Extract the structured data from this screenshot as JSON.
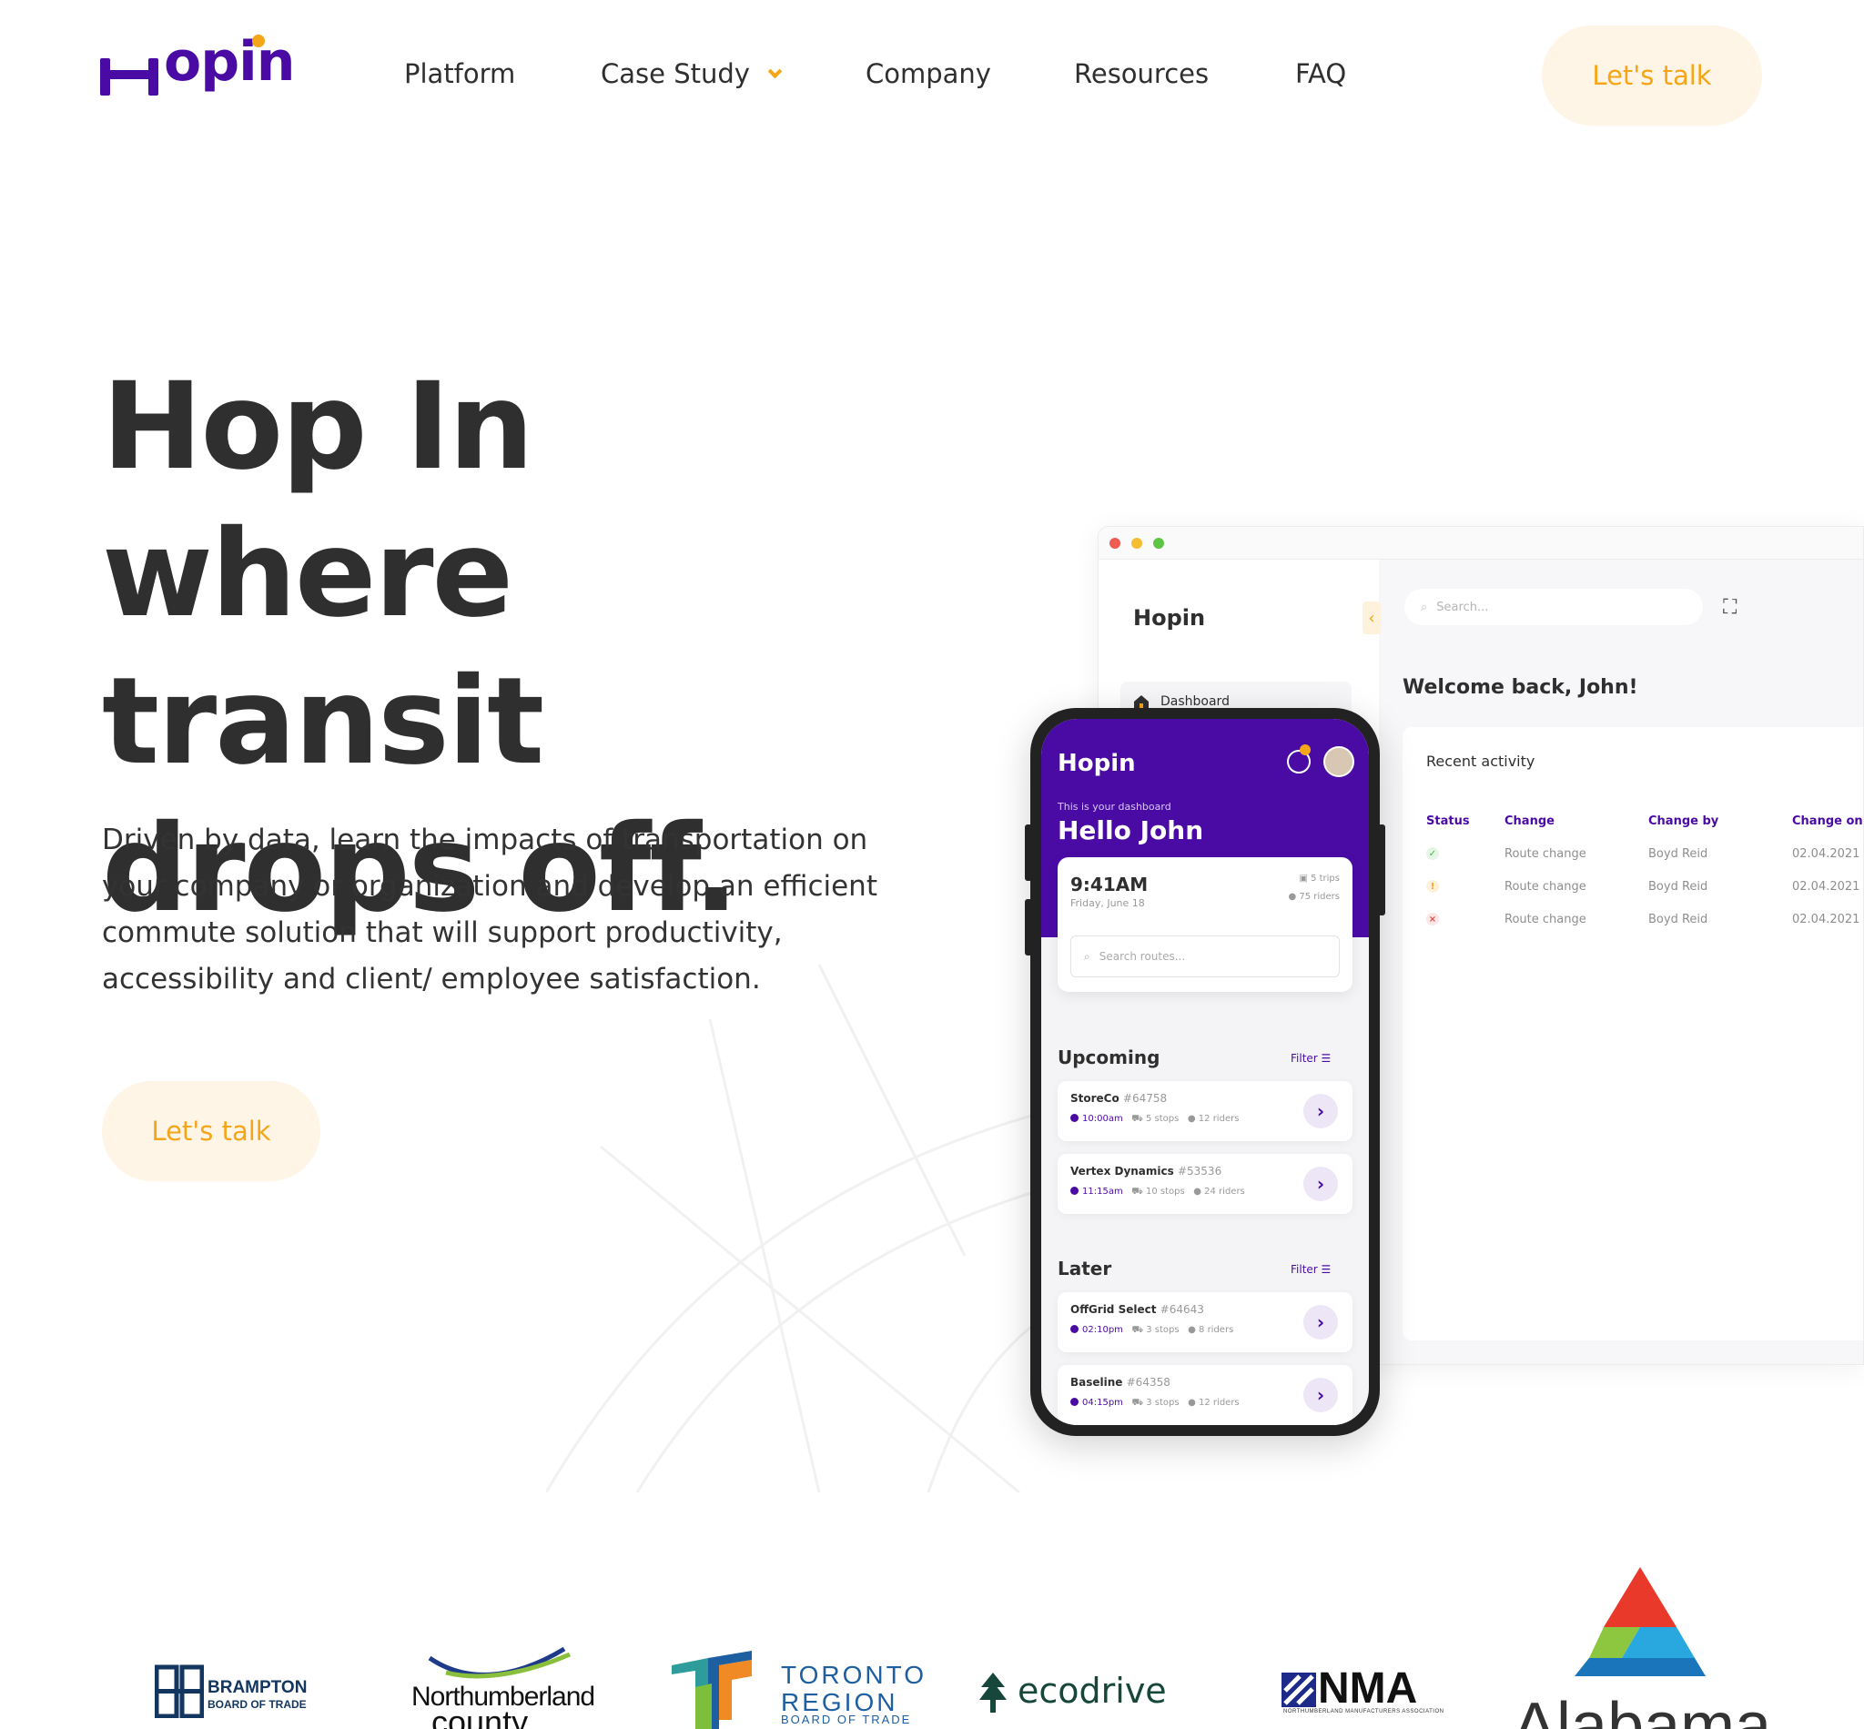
{
  "header": {
    "logo_text": "Hopin",
    "nav": [
      {
        "label": "Platform"
      },
      {
        "label": "Case Study"
      },
      {
        "label": "Company"
      },
      {
        "label": "Resources"
      },
      {
        "label": "FAQ"
      }
    ],
    "cta_label": "Let's talk"
  },
  "hero": {
    "title": "Hop In where transit drops off.",
    "subtitle": "Driven by data, learn the impacts of transportation on your company or organization and develop an efficient commute solution that will support productivity, accessibility and client/ employee satisfaction.",
    "cta_label": "Let's talk"
  },
  "desktop_app": {
    "logo": "Hopin",
    "collapse_icon": "chevron-left-icon",
    "nav_item": "Dashboard",
    "search_placeholder": "Search...",
    "welcome": "Welcome back, John!",
    "card_title": "Recent activity",
    "columns": [
      "Status",
      "Change",
      "Change by",
      "Change on"
    ],
    "rows": [
      {
        "status": "success",
        "change": "Route change",
        "by": "Boyd Reid",
        "on": "02.04.2021"
      },
      {
        "status": "warning",
        "change": "Route change",
        "by": "Boyd Reid",
        "on": "02.04.2021"
      },
      {
        "status": "error",
        "change": "Route change",
        "by": "Boyd Reid",
        "on": "02.04.2021"
      }
    ]
  },
  "phone_app": {
    "logo": "Hopin",
    "dashboard_caption": "This is your dashboard",
    "greeting": "Hello John",
    "time": "9:41AM",
    "date": "Friday, June 18",
    "trips_count": "5 trips",
    "riders_count": "75 riders",
    "search_placeholder": "Search routes...",
    "upcoming_label": "Upcoming",
    "later_label": "Later",
    "filter_label": "Filter",
    "upcoming": [
      {
        "name": "StoreCo",
        "id": "#64758",
        "time": "10:00am",
        "stops": "5 stops",
        "riders": "12 riders"
      },
      {
        "name": "Vertex Dynamics",
        "id": "#53536",
        "time": "11:15am",
        "stops": "10 stops",
        "riders": "24 riders"
      }
    ],
    "later": [
      {
        "name": "OffGrid Select",
        "id": "#64643",
        "time": "02:10pm",
        "stops": "3 stops",
        "riders": "8 riders"
      },
      {
        "name": "Baseline",
        "id": "#64358",
        "time": "04:15pm",
        "stops": "3 stops",
        "riders": "12 riders"
      }
    ]
  },
  "partners": {
    "brampton": {
      "line1": "BRAMPTON",
      "line2": "BOARD OF TRADE"
    },
    "northumberland": {
      "line1": "Northumberland",
      "line2": "county"
    },
    "toronto": {
      "line1": "TORONTO",
      "line2": "REGION",
      "line3": "BOARD OF TRADE"
    },
    "ecodrive": {
      "name": "ecodrive"
    },
    "nma": {
      "name": "NMA",
      "sub": "NORTHUMBERLAND MANUFACTURERS ASSOCIATION"
    },
    "alabama": {
      "name": "Alabama"
    }
  },
  "colors": {
    "brand_purple": "#4a0ba5",
    "accent_orange": "#f5a518",
    "cta_bg": "#fff5e6",
    "text_dark": "#2f2f2f"
  }
}
